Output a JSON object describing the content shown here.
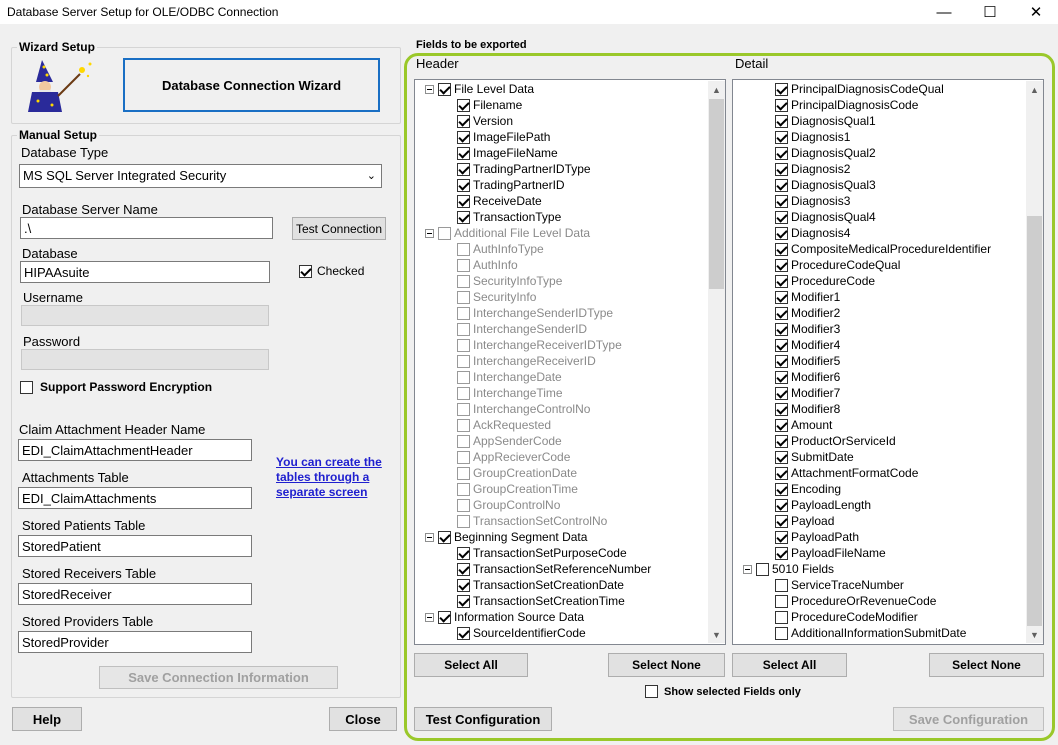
{
  "window": {
    "title": "Database Server Setup for OLE/ODBC Connection",
    "minimize": "—",
    "maximize": "☐",
    "close": "✕"
  },
  "wizard": {
    "legend": "Wizard Setup",
    "button": "Database Connection Wizard"
  },
  "manual": {
    "legend": "Manual Setup",
    "db_type_label": "Database Type",
    "db_type_value": "MS SQL Server Integrated Security",
    "server_label": "Database Server Name",
    "server_value": ".\\",
    "test_connection": "Test Connection",
    "database_label": "Database",
    "database_value": "HIPAAsuite",
    "checked_label": "Checked",
    "username_label": "Username",
    "username_value": "",
    "password_label": "Password",
    "password_value": "",
    "support_encryption": "Support Password Encryption",
    "claim_header_label": "Claim Attachment Header Name",
    "claim_header_value": "EDI_ClaimAttachmentHeader",
    "attachments_label": "Attachments Table",
    "attachments_value": "EDI_ClaimAttachments",
    "patients_label": "Stored Patients Table",
    "patients_value": "StoredPatient",
    "receivers_label": "Stored Receivers Table",
    "receivers_value": "StoredReceiver",
    "providers_label": "Stored Providers Table",
    "providers_value": "StoredProvider",
    "link_line1": "You can create the",
    "link_line2": "tables through a",
    "link_line3": "separate screen",
    "save_connection": "Save Connection Information"
  },
  "bottom_left": {
    "help": "Help",
    "close": "Close"
  },
  "export": {
    "legend": "Fields to be exported",
    "header_title": "Header",
    "detail_title": "Detail",
    "select_all": "Select All",
    "select_none": "Select None",
    "show_selected": "Show selected Fields only",
    "test_configuration": "Test Configuration",
    "save_configuration": "Save Configuration",
    "header_items": [
      {
        "label": "File Level Data",
        "level": 0,
        "checked": true,
        "expander": true,
        "dim": false
      },
      {
        "label": "Filename",
        "level": 1,
        "checked": true,
        "dim": false
      },
      {
        "label": "Version",
        "level": 1,
        "checked": true,
        "dim": false
      },
      {
        "label": "ImageFilePath",
        "level": 1,
        "checked": true,
        "dim": false
      },
      {
        "label": "ImageFileName",
        "level": 1,
        "checked": true,
        "dim": false
      },
      {
        "label": "TradingPartnerIDType",
        "level": 1,
        "checked": true,
        "dim": false
      },
      {
        "label": "TradingPartnerID",
        "level": 1,
        "checked": true,
        "dim": false
      },
      {
        "label": "ReceiveDate",
        "level": 1,
        "checked": true,
        "dim": false
      },
      {
        "label": "TransactionType",
        "level": 1,
        "checked": true,
        "dim": false
      },
      {
        "label": "Additional File Level Data",
        "level": 0,
        "checked": false,
        "expander": true,
        "dim": true
      },
      {
        "label": "AuthInfoType",
        "level": 1,
        "checked": false,
        "dim": true
      },
      {
        "label": "AuthInfo",
        "level": 1,
        "checked": false,
        "dim": true
      },
      {
        "label": "SecurityInfoType",
        "level": 1,
        "checked": false,
        "dim": true
      },
      {
        "label": "SecurityInfo",
        "level": 1,
        "checked": false,
        "dim": true
      },
      {
        "label": "InterchangeSenderIDType",
        "level": 1,
        "checked": false,
        "dim": true
      },
      {
        "label": "InterchangeSenderID",
        "level": 1,
        "checked": false,
        "dim": true
      },
      {
        "label": "InterchangeReceiverIDType",
        "level": 1,
        "checked": false,
        "dim": true
      },
      {
        "label": "InterchangeReceiverID",
        "level": 1,
        "checked": false,
        "dim": true
      },
      {
        "label": "InterchangeDate",
        "level": 1,
        "checked": false,
        "dim": true
      },
      {
        "label": "InterchangeTime",
        "level": 1,
        "checked": false,
        "dim": true
      },
      {
        "label": "InterchangeControlNo",
        "level": 1,
        "checked": false,
        "dim": true
      },
      {
        "label": "AckRequested",
        "level": 1,
        "checked": false,
        "dim": true
      },
      {
        "label": "AppSenderCode",
        "level": 1,
        "checked": false,
        "dim": true
      },
      {
        "label": "AppRecieverCode",
        "level": 1,
        "checked": false,
        "dim": true
      },
      {
        "label": "GroupCreationDate",
        "level": 1,
        "checked": false,
        "dim": true
      },
      {
        "label": "GroupCreationTime",
        "level": 1,
        "checked": false,
        "dim": true
      },
      {
        "label": "GroupControlNo",
        "level": 1,
        "checked": false,
        "dim": true
      },
      {
        "label": "TransactionSetControlNo",
        "level": 1,
        "checked": false,
        "dim": true
      },
      {
        "label": "Beginning Segment Data",
        "level": 0,
        "checked": true,
        "expander": true,
        "dim": false
      },
      {
        "label": "TransactionSetPurposeCode",
        "level": 1,
        "checked": true,
        "dim": false
      },
      {
        "label": "TransactionSetReferenceNumber",
        "level": 1,
        "checked": true,
        "dim": false
      },
      {
        "label": "TransactionSetCreationDate",
        "level": 1,
        "checked": true,
        "dim": false
      },
      {
        "label": "TransactionSetCreationTime",
        "level": 1,
        "checked": true,
        "dim": false
      },
      {
        "label": "Information Source Data",
        "level": 0,
        "checked": true,
        "expander": true,
        "dim": false
      },
      {
        "label": "SourceIdentifierCode",
        "level": 1,
        "checked": true,
        "dim": false
      }
    ],
    "detail_items": [
      {
        "label": "PrincipalDiagnosisCodeQual",
        "level": 1,
        "checked": true,
        "dim": false
      },
      {
        "label": "PrincipalDiagnosisCode",
        "level": 1,
        "checked": true,
        "dim": false
      },
      {
        "label": "DiagnosisQual1",
        "level": 1,
        "checked": true,
        "dim": false
      },
      {
        "label": "Diagnosis1",
        "level": 1,
        "checked": true,
        "dim": false
      },
      {
        "label": "DiagnosisQual2",
        "level": 1,
        "checked": true,
        "dim": false
      },
      {
        "label": "Diagnosis2",
        "level": 1,
        "checked": true,
        "dim": false
      },
      {
        "label": "DiagnosisQual3",
        "level": 1,
        "checked": true,
        "dim": false
      },
      {
        "label": "Diagnosis3",
        "level": 1,
        "checked": true,
        "dim": false
      },
      {
        "label": "DiagnosisQual4",
        "level": 1,
        "checked": true,
        "dim": false
      },
      {
        "label": "Diagnosis4",
        "level": 1,
        "checked": true,
        "dim": false
      },
      {
        "label": "CompositeMedicalProcedureIdentifier",
        "level": 1,
        "checked": true,
        "dim": false
      },
      {
        "label": "ProcedureCodeQual",
        "level": 1,
        "checked": true,
        "dim": false
      },
      {
        "label": "ProcedureCode",
        "level": 1,
        "checked": true,
        "dim": false
      },
      {
        "label": "Modifier1",
        "level": 1,
        "checked": true,
        "dim": false
      },
      {
        "label": "Modifier2",
        "level": 1,
        "checked": true,
        "dim": false
      },
      {
        "label": "Modifier3",
        "level": 1,
        "checked": true,
        "dim": false
      },
      {
        "label": "Modifier4",
        "level": 1,
        "checked": true,
        "dim": false
      },
      {
        "label": "Modifier5",
        "level": 1,
        "checked": true,
        "dim": false
      },
      {
        "label": "Modifier6",
        "level": 1,
        "checked": true,
        "dim": false
      },
      {
        "label": "Modifier7",
        "level": 1,
        "checked": true,
        "dim": false
      },
      {
        "label": "Modifier8",
        "level": 1,
        "checked": true,
        "dim": false
      },
      {
        "label": "Amount",
        "level": 1,
        "checked": true,
        "dim": false
      },
      {
        "label": "ProductOrServiceId",
        "level": 1,
        "checked": true,
        "dim": false
      },
      {
        "label": "SubmitDate",
        "level": 1,
        "checked": true,
        "dim": false
      },
      {
        "label": "AttachmentFormatCode",
        "level": 1,
        "checked": true,
        "dim": false
      },
      {
        "label": "Encoding",
        "level": 1,
        "checked": true,
        "dim": false
      },
      {
        "label": "PayloadLength",
        "level": 1,
        "checked": true,
        "dim": false
      },
      {
        "label": "Payload",
        "level": 1,
        "checked": true,
        "dim": false
      },
      {
        "label": "PayloadPath",
        "level": 1,
        "checked": true,
        "dim": false
      },
      {
        "label": "PayloadFileName",
        "level": 1,
        "checked": true,
        "dim": false
      },
      {
        "label": "5010 Fields",
        "level": 0,
        "checked": false,
        "expander": true,
        "dim": false
      },
      {
        "label": "ServiceTraceNumber",
        "level": 1,
        "checked": false,
        "dim": false
      },
      {
        "label": "ProcedureOrRevenueCode",
        "level": 1,
        "checked": false,
        "dim": false
      },
      {
        "label": "ProcedureCodeModifier",
        "level": 1,
        "checked": false,
        "dim": false
      },
      {
        "label": "AdditionalInformationSubmitDate",
        "level": 1,
        "checked": false,
        "dim": false
      }
    ]
  },
  "colors": {
    "highlight_border": "#9ac82a",
    "link": "#1f1fcf",
    "wizard_border": "#1a6fc4"
  }
}
